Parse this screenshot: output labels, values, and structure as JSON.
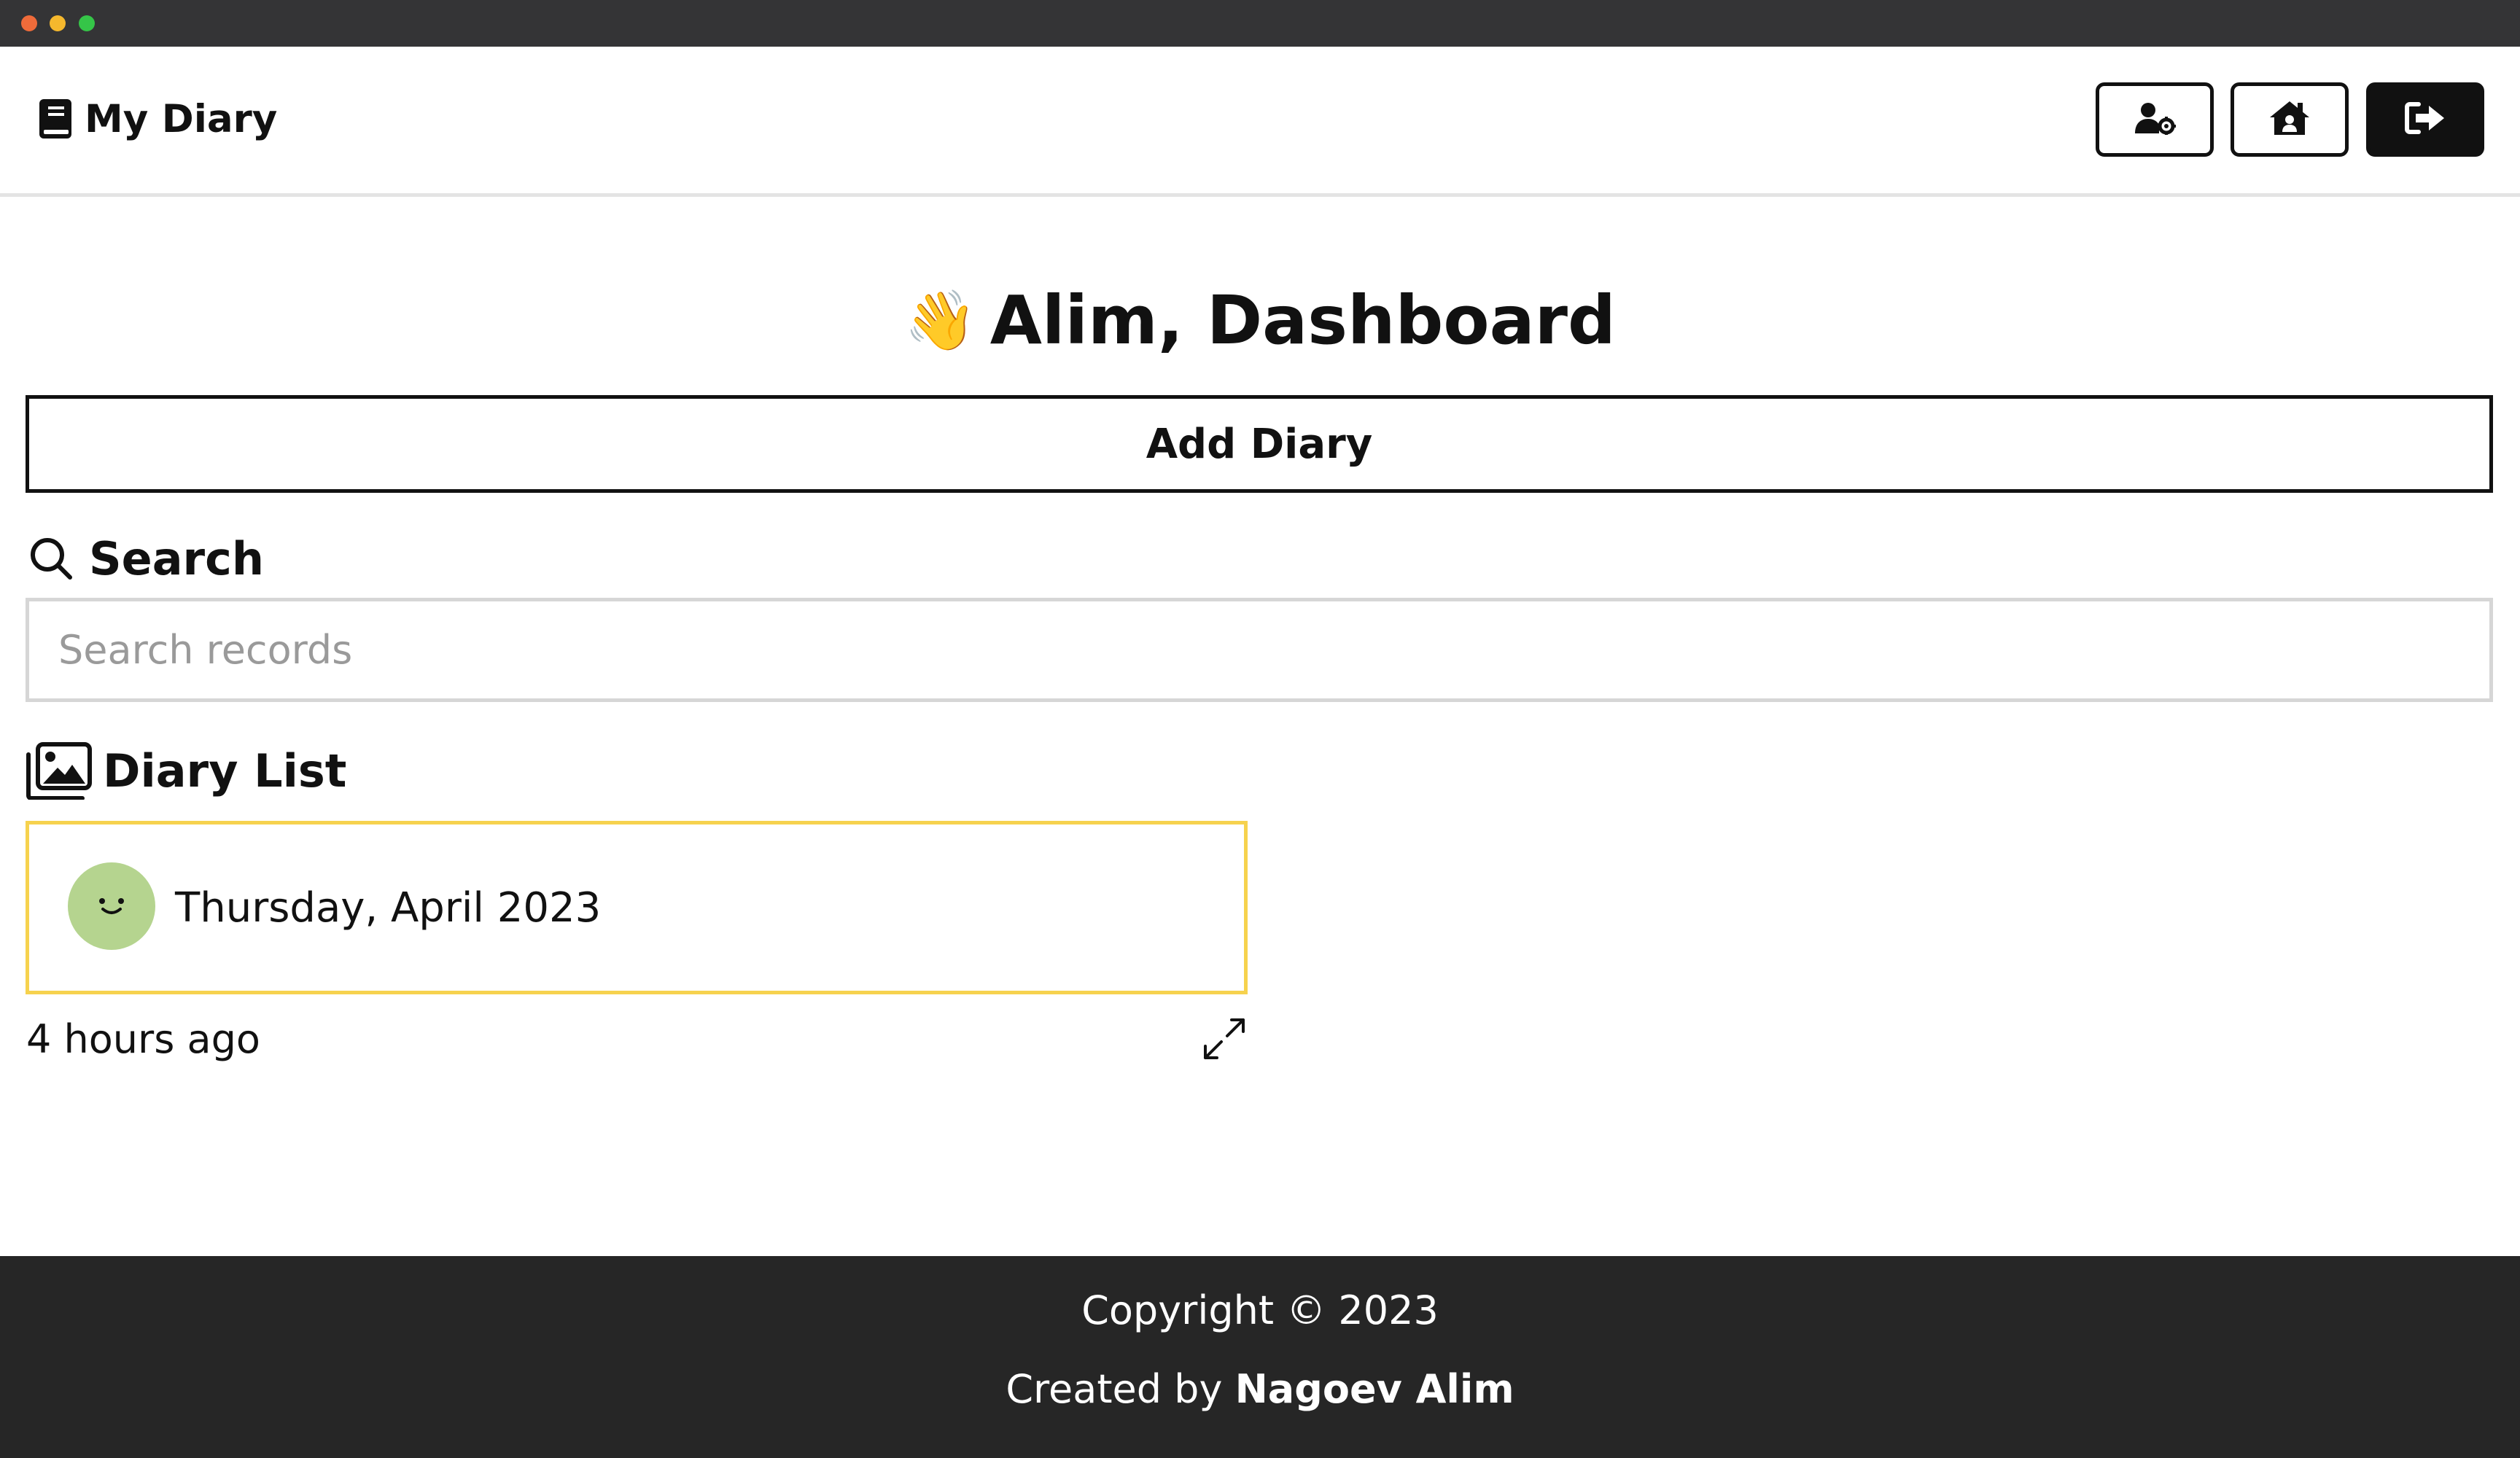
{
  "brand": {
    "title": "My Diary",
    "icon": "book-icon"
  },
  "nav": {
    "buttons": [
      {
        "name": "profile-settings-button",
        "icon": "user-gear-icon"
      },
      {
        "name": "home-button",
        "icon": "house-user-icon"
      },
      {
        "name": "logout-button",
        "icon": "sign-out-icon"
      }
    ]
  },
  "dashboard": {
    "wave_emoji": "👋",
    "title": "Alim, Dashboard",
    "add_button_label": "Add Diary"
  },
  "search": {
    "heading": "Search",
    "icon": "search-icon",
    "placeholder": "Search records",
    "value": ""
  },
  "diary_list": {
    "heading": "Diary List",
    "icon": "images-icon",
    "items": [
      {
        "date": "Thursday, April 2023",
        "mood_icon": "smiley-face-icon",
        "mood_color": "#b5d48f",
        "time_ago": "4 hours ago",
        "expand_icon": "expand-icon"
      }
    ]
  },
  "footer": {
    "copyright": "Copyright © 2023",
    "created_prefix": "Created by ",
    "author": "Nagoev Alim"
  },
  "colors": {
    "titlebar": "#343436",
    "footer_bg": "#262626",
    "card_border": "#f6d24e",
    "accent_dark": "#111111"
  }
}
